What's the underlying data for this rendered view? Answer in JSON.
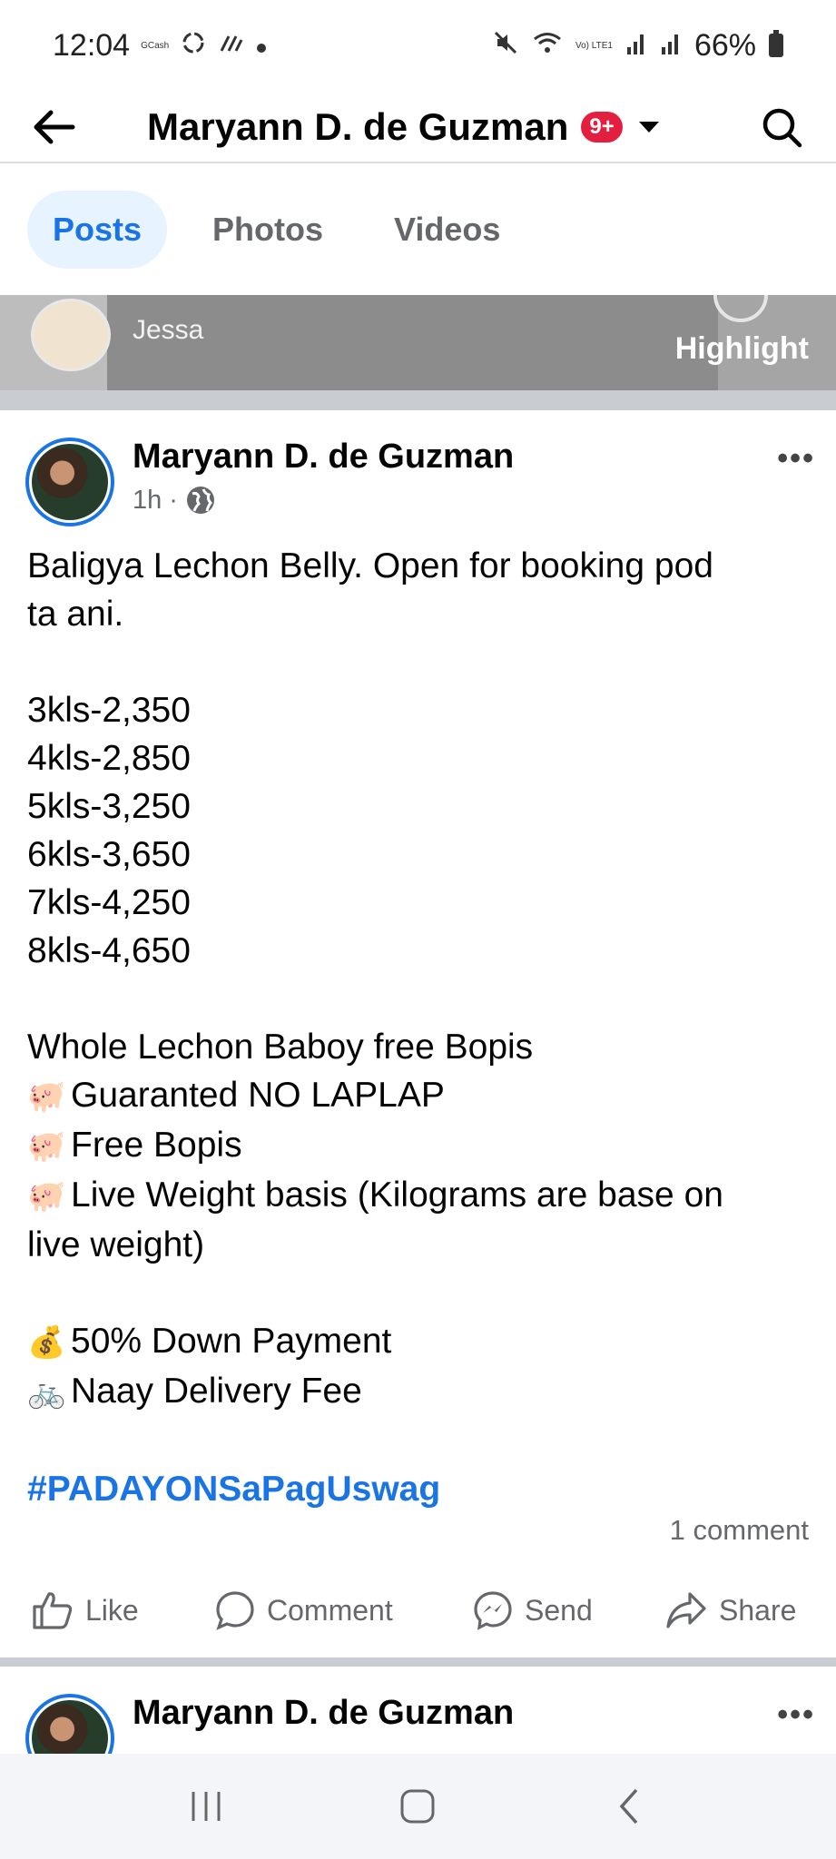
{
  "status_bar": {
    "time": "12:04",
    "app_label": "GCash",
    "network": "Vo) LTE1",
    "battery": "66%"
  },
  "header": {
    "title": "Maryann D. de Guzman",
    "badge": "9+"
  },
  "tabs": [
    {
      "label": "Posts",
      "active": true
    },
    {
      "label": "Photos",
      "active": false
    },
    {
      "label": "Videos",
      "active": false
    }
  ],
  "highlight_strip": {
    "name": "Jessa",
    "label": "Highlight"
  },
  "post": {
    "author": "Maryann D. de Guzman",
    "time": "1h",
    "separator": "·",
    "body": {
      "intro_1": "Baligya Lechon Belly. Open for booking pod",
      "intro_2": "ta ani.",
      "prices": [
        "3kls-2,350",
        "4kls-2,850",
        "5kls-3,250",
        "6kls-3,650",
        "7kls-4,250",
        "8kls-4,650"
      ],
      "whole_title": "Whole Lechon Baboy free Bopis",
      "perks": [
        {
          "emoji": "🐖",
          "text": "Guaranted NO LAPLAP"
        },
        {
          "emoji": "🐖",
          "text": "Free Bopis"
        },
        {
          "emoji": "🐖",
          "text": "Live Weight basis (Kilograms are base on"
        }
      ],
      "perk_cont": "live weight)",
      "terms": [
        {
          "emoji": "💰",
          "text": "50% Down Payment"
        },
        {
          "emoji": "🚲",
          "text": "Naay Delivery Fee"
        }
      ],
      "hashtag": "#PADAYONSaPagUswag"
    },
    "comment_count": "1 comment",
    "actions": {
      "like": "Like",
      "comment": "Comment",
      "send": "Send",
      "share": "Share"
    }
  },
  "next_post": {
    "author": "Maryann D. de Guzman"
  },
  "colors": {
    "accent": "#1b74e4",
    "tab_active_bg": "#e7f3ff",
    "secondary_text": "#65676b",
    "badge": "#e41e3f"
  }
}
